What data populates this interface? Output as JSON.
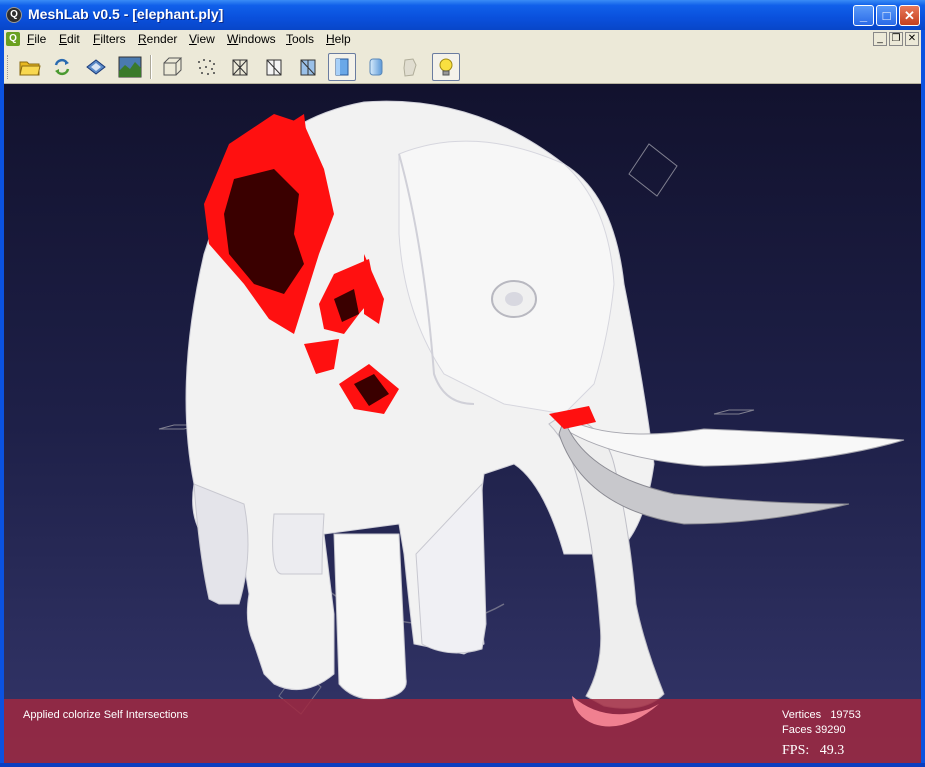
{
  "window": {
    "title": "MeshLab v0.5 - [elephant.ply]",
    "app_icon_glyph": "Q",
    "minimize_glyph": "_",
    "maximize_glyph": "□",
    "close_glyph": "✕"
  },
  "menubar": {
    "logo_glyph": "Q",
    "items": [
      {
        "first": "F",
        "rest": "ile"
      },
      {
        "first": "E",
        "rest": "dit"
      },
      {
        "first": "F",
        "rest": "ilters"
      },
      {
        "first": "R",
        "rest": "ender"
      },
      {
        "first": "V",
        "rest": "iew"
      },
      {
        "first": "W",
        "rest": "indows"
      },
      {
        "first": "T",
        "rest": "ools"
      },
      {
        "first": "H",
        "rest": "elp"
      }
    ],
    "mdi_minimize": "_",
    "mdi_restore": "❐",
    "mdi_close": "✕"
  },
  "toolbar": {
    "buttons": [
      {
        "name": "open-folder-icon",
        "active": false
      },
      {
        "name": "reload-icon",
        "active": false
      },
      {
        "name": "save-disk-icon",
        "active": false
      },
      {
        "name": "snapshot-image-icon",
        "active": false
      },
      {
        "name": "bounding-box-icon",
        "active": false
      },
      {
        "name": "points-render-icon",
        "active": false
      },
      {
        "name": "wireframe-icon",
        "active": false
      },
      {
        "name": "hidden-lines-icon",
        "active": false
      },
      {
        "name": "flat-lines-icon",
        "active": false
      },
      {
        "name": "flat-shading-icon",
        "active": true
      },
      {
        "name": "smooth-shading-icon",
        "active": false
      },
      {
        "name": "texture-icon",
        "active": false
      },
      {
        "name": "lighting-bulb-icon",
        "active": true
      }
    ]
  },
  "viewport": {
    "status_message": "Applied colorize Self Intersections",
    "vertices_label": "Vertices",
    "vertices_value": "19753",
    "faces_label": "Faces",
    "faces_value": "39290",
    "fps_label": "FPS:",
    "fps_value": "49.3"
  },
  "colors": {
    "titlebar": "#0a50dc",
    "menubar_bg": "#ece9d8",
    "viewport_top": "#12122e",
    "viewport_bottom": "#34366a",
    "status_overlay": "#a02840",
    "self_intersection": "#ff0000"
  }
}
